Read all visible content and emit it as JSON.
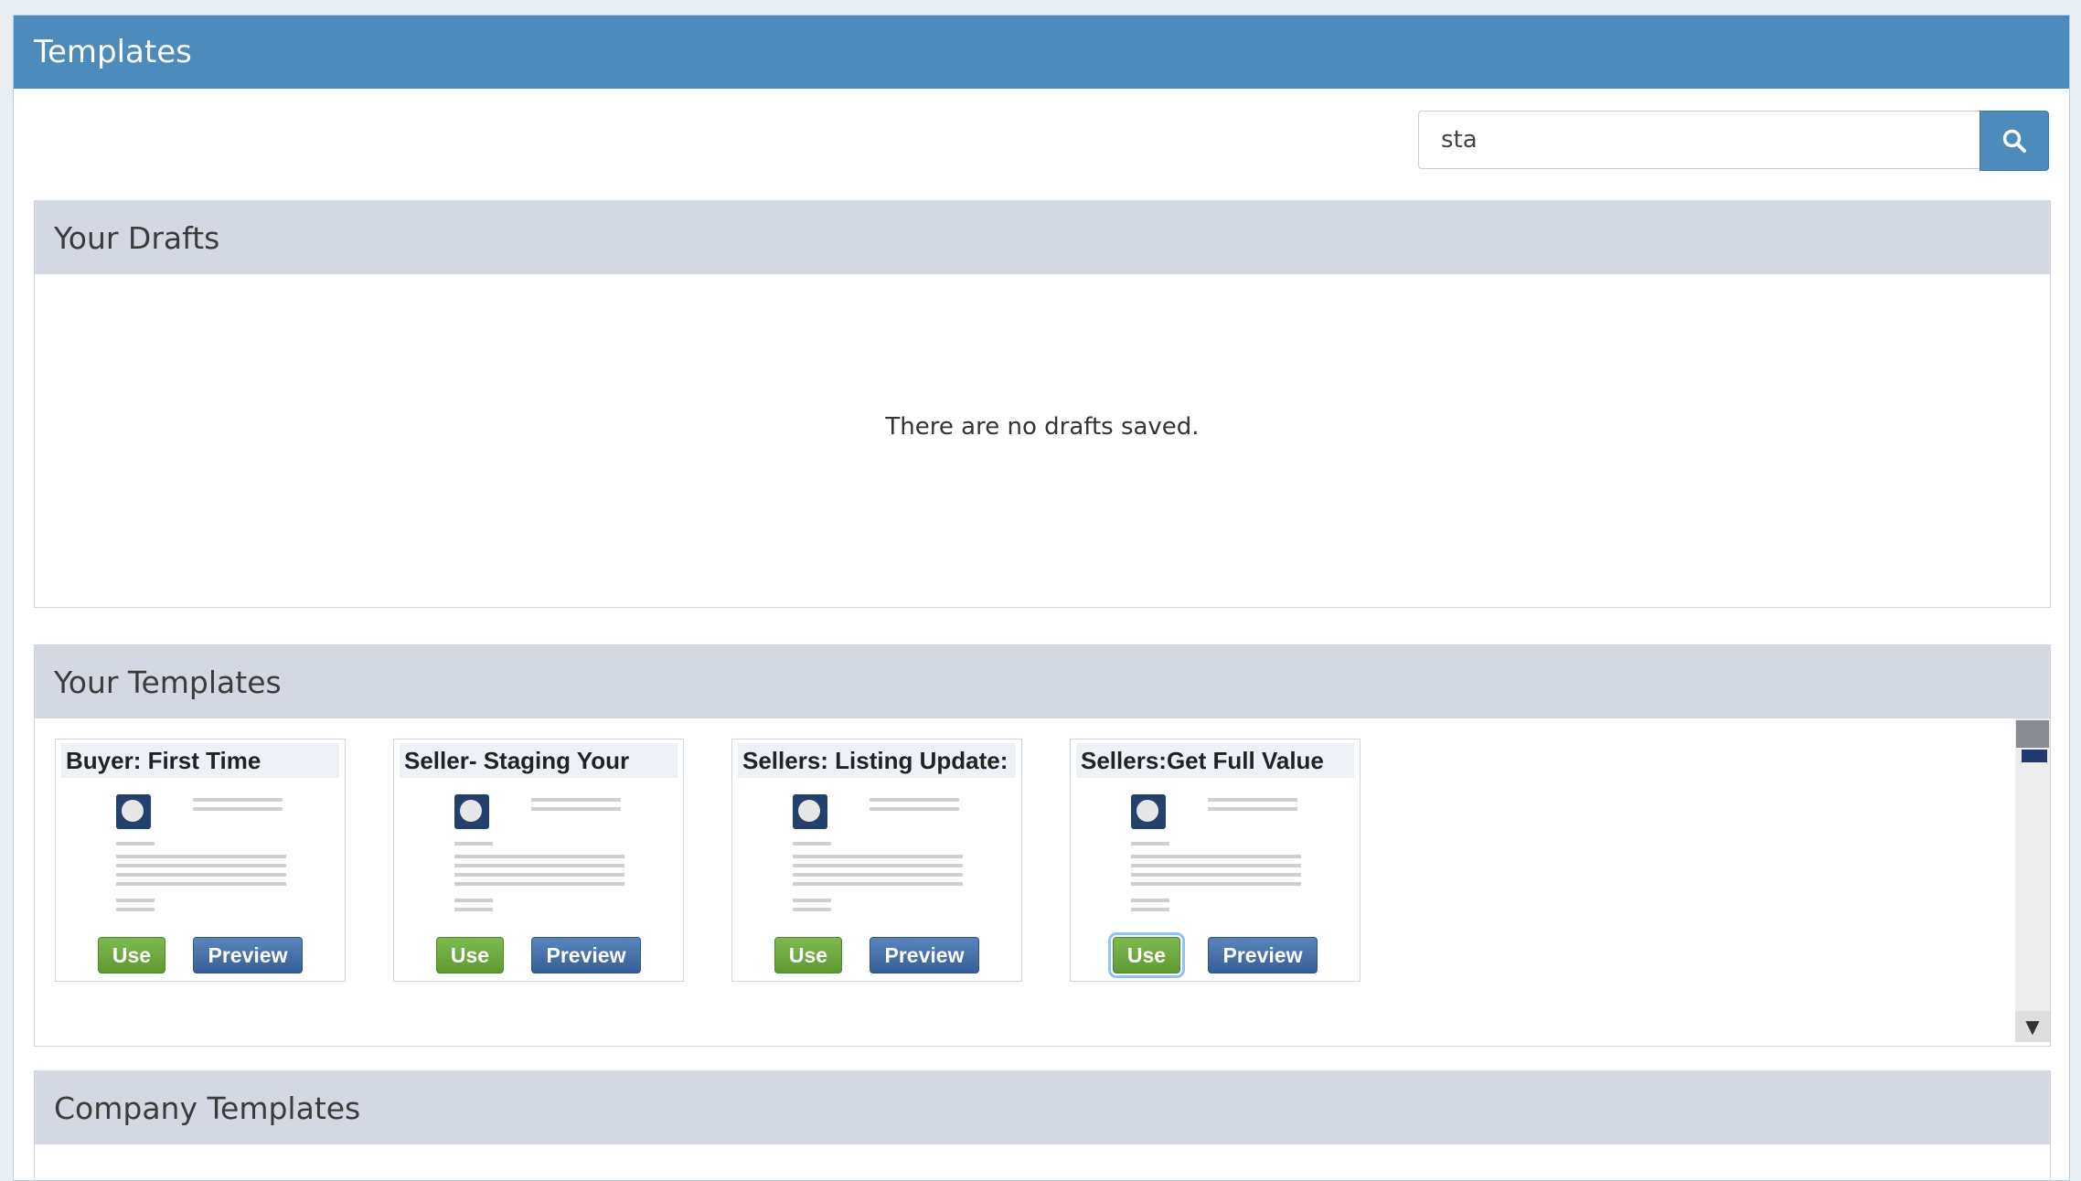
{
  "header": {
    "title": "Templates"
  },
  "search": {
    "value": "sta",
    "button_icon": "search-icon"
  },
  "drafts": {
    "title": "Your Drafts",
    "empty_text": "There are no drafts saved."
  },
  "your_templates": {
    "title": "Your Templates",
    "cards": [
      {
        "title": "Buyer: First Time",
        "use_label": "Use",
        "preview_label": "Preview"
      },
      {
        "title": "Seller- Staging Your",
        "use_label": "Use",
        "preview_label": "Preview"
      },
      {
        "title": "Sellers: Listing Update:",
        "use_label": "Use",
        "preview_label": "Preview"
      },
      {
        "title": "Sellers:Get Full Value",
        "use_label": "Use",
        "preview_label": "Preview"
      }
    ]
  },
  "company_templates": {
    "title": "Company Templates"
  },
  "colors": {
    "header_bg": "#4e8bbd",
    "panel_head_bg": "#d3d8e2",
    "use_button": "#6aa83d",
    "preview_button": "#44699f"
  }
}
